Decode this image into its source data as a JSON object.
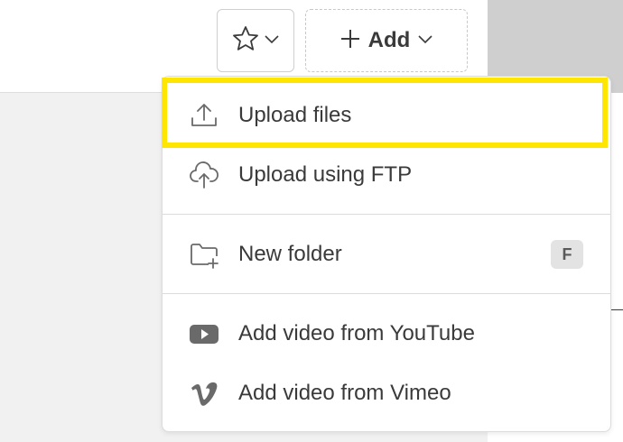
{
  "toolbar": {
    "star_icon": "star-icon",
    "add_label": "Add"
  },
  "menu": {
    "items": [
      {
        "label": "Upload files",
        "icon": "upload-icon"
      },
      {
        "label": "Upload using FTP",
        "icon": "cloud-upload-icon"
      },
      {
        "label": "New folder",
        "icon": "folder-plus-icon",
        "shortcut": "F"
      },
      {
        "label": "Add video from YouTube",
        "icon": "youtube-icon"
      },
      {
        "label": "Add video from Vimeo",
        "icon": "vimeo-icon"
      }
    ]
  },
  "colors": {
    "highlight": "#ffe600",
    "text": "#3a3a3a",
    "icon": "#6a6a6a"
  }
}
